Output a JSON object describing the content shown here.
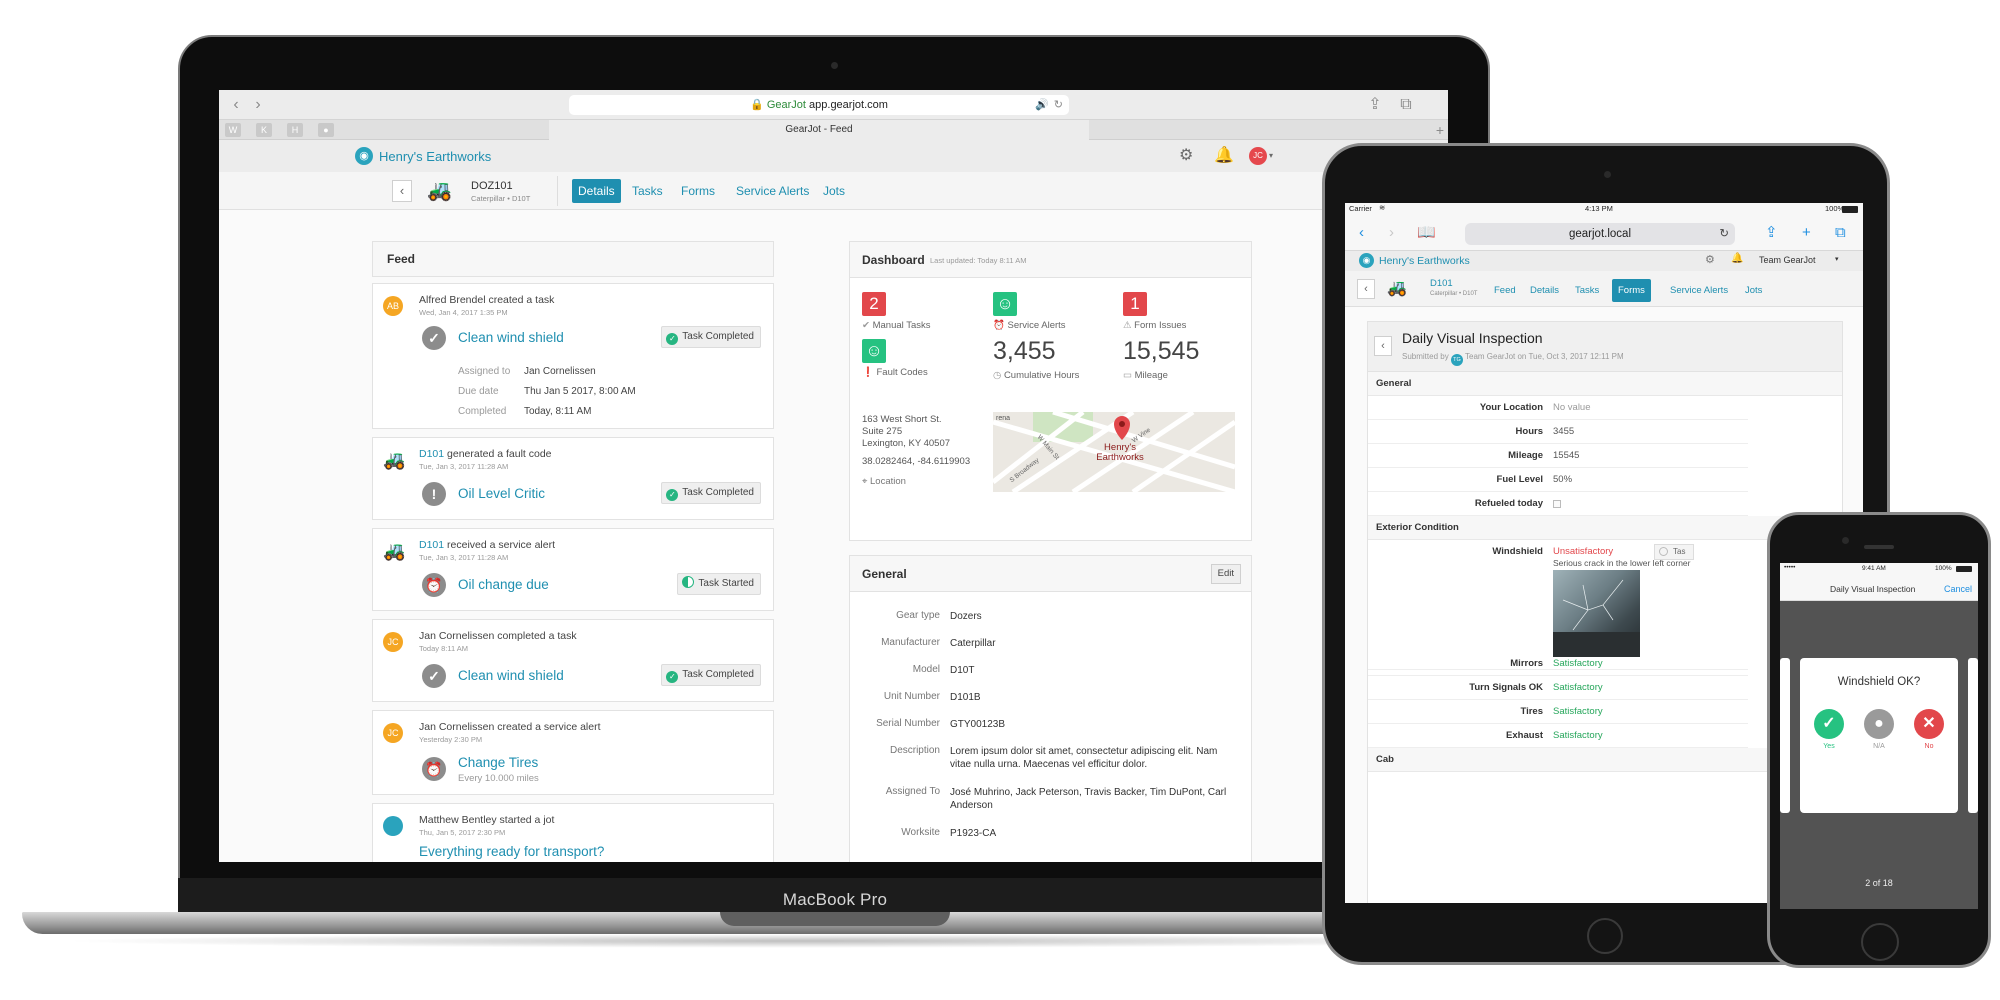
{
  "laptop": {
    "brand": "MacBook Pro",
    "browser": {
      "url_domain": "GearJot",
      "url_host": "app.gearjot.com",
      "tab_title": "GearJot - Feed",
      "favorites": [
        "W",
        "K",
        "H",
        "●"
      ]
    },
    "app": {
      "company": "Henry's Earthworks",
      "user_initials": "JC",
      "unit": {
        "name": "DOZ101",
        "subtitle": "Caterpillar • D10T"
      },
      "tabs": [
        "Details",
        "Tasks",
        "Forms",
        "Service Alerts",
        "Jots"
      ],
      "active_tab": "Details"
    },
    "feed": {
      "title": "Feed",
      "items": [
        {
          "avatar": "AB",
          "actor": "Alfred Brendel created a task",
          "time": "Wed, Jan 4, 2017 1:35 PM",
          "title": "Clean wind shield",
          "status": "Task Completed",
          "details": [
            {
              "k": "Assigned to",
              "v": "Jan Cornelissen"
            },
            {
              "k": "Due date",
              "v": "Thu Jan 5 2017, 8:00 AM"
            },
            {
              "k": "Completed",
              "v": "Today, 8:11 AM"
            }
          ]
        },
        {
          "avatar": "",
          "actor_link": "D101",
          "actor": " generated a fault code",
          "time": "Tue, Jan 3, 2017 11:28 AM",
          "title": "Oil Level Critic",
          "status": "Task Completed"
        },
        {
          "avatar": "",
          "actor_link": "D101",
          "actor": " received a service alert",
          "time": "Tue, Jan 3, 2017 11:28 AM",
          "title": "Oil change due",
          "status": "Task Started"
        },
        {
          "avatar": "JC",
          "actor": "Jan Cornelissen completed a task",
          "time": "Today 8:11 AM",
          "title": "Clean wind shield",
          "status": "Task Completed"
        },
        {
          "avatar": "JC",
          "actor": "Jan Cornelissen created a service alert",
          "time": "Yesterday 2:30 PM",
          "title": "Change Tires",
          "subtitle": "Every 10.000 miles"
        },
        {
          "avatar": "",
          "actor": "Matthew Bentley started a jot",
          "time": "Thu, Jan 5, 2017 2:30 PM",
          "title": "Everything ready for transport?"
        }
      ]
    },
    "dashboard": {
      "title": "Dashboard",
      "updated": "Last updated: Today 8:11 AM",
      "stats": [
        {
          "value": "2",
          "label": "Manual Tasks",
          "color": "#e2474b"
        },
        {
          "value": "",
          "label": "Service Alerts",
          "color": "#26c281"
        },
        {
          "value": "1",
          "label": "Form Issues",
          "color": "#e2474b"
        },
        {
          "value": "",
          "label": "Fault Codes",
          "color": "#26c281"
        },
        {
          "value": "3,455",
          "label": "Cumulative Hours"
        },
        {
          "value": "15,545",
          "label": "Mileage"
        }
      ],
      "address": [
        "163 West Short St.",
        "Suite 275",
        "Lexington, KY 40507"
      ],
      "coords": "38.0282464, -84.6119903",
      "location_label": "Location",
      "map_pin_label": "Henry's Earthworks",
      "map_street_labels": [
        "rena",
        "S Broadway",
        "W Main St",
        "W Vine"
      ]
    },
    "general": {
      "title": "General",
      "edit": "Edit",
      "rows": [
        {
          "k": "Gear type",
          "v": "Dozers"
        },
        {
          "k": "Manufacturer",
          "v": "Caterpillar"
        },
        {
          "k": "Model",
          "v": "D10T"
        },
        {
          "k": "Unit Number",
          "v": "D101B"
        },
        {
          "k": "Serial Number",
          "v": "GTY00123B"
        },
        {
          "k": "Description",
          "v": "Lorem ipsum dolor sit amet, consectetur adipiscing elit. Nam vitae nulla urna. Maecenas vel efficitur dolor."
        },
        {
          "k": "Assigned To",
          "v": "José Muhrino, Jack Peterson, Travis Backer,  Tim DuPont, Carl Anderson"
        },
        {
          "k": "Worksite",
          "v": "P1923-CA"
        }
      ]
    }
  },
  "tablet": {
    "status": {
      "carrier": "Carrier",
      "time": "4:13 PM",
      "battery": "100%"
    },
    "url": "gearjot.local",
    "company": "Henry's Earthworks",
    "team": "Team GearJot",
    "unit": {
      "name": "D101",
      "subtitle": "Caterpillar • D10T"
    },
    "tabs": [
      "Feed",
      "Details",
      "Tasks",
      "Forms",
      "Service Alerts",
      "Jots"
    ],
    "active_tab": "Forms",
    "form": {
      "title": "Daily Visual Inspection",
      "submitted_prefix": "Submitted by",
      "submitted_initials": "TG",
      "submitted_rest": "Team GearJot on Tue, Oct 3, 2017 12:11 PM",
      "sections": [
        {
          "title": "General",
          "rows": [
            {
              "k": "Your Location",
              "v": "No value"
            },
            {
              "k": "Hours",
              "v": "3455"
            },
            {
              "k": "Mileage",
              "v": "15545"
            },
            {
              "k": "Fuel Level",
              "v": "50%"
            },
            {
              "k": "Refueled today",
              "v": ""
            }
          ]
        },
        {
          "title": "Exterior Condition",
          "rows": [
            {
              "k": "Windshield",
              "v": "Unsatisfactory",
              "note": "Serious crack in the lower left corner",
              "task_label": "Tas"
            },
            {
              "k": "Mirrors",
              "v": "Satisfactory"
            },
            {
              "k": "Turn Signals OK",
              "v": "Satisfactory"
            },
            {
              "k": "Tires",
              "v": "Satisfactory"
            },
            {
              "k": "Exhaust",
              "v": "Satisfactory"
            }
          ]
        },
        {
          "title": "Cab",
          "rows": []
        }
      ]
    }
  },
  "phone": {
    "status": {
      "carrier": "•••••",
      "time": "9:41 AM",
      "battery": "100%"
    },
    "title": "Daily Visual Inspection",
    "cancel": "Cancel",
    "question": "Windshield OK?",
    "choices": [
      {
        "label": "Yes",
        "glyph": "✓",
        "color": "#26c281"
      },
      {
        "label": "N/A",
        "glyph": "●",
        "color": "#9a9a9a"
      },
      {
        "label": "No",
        "glyph": "✕",
        "color": "#e2474b"
      }
    ],
    "progress": "2 of 18"
  }
}
